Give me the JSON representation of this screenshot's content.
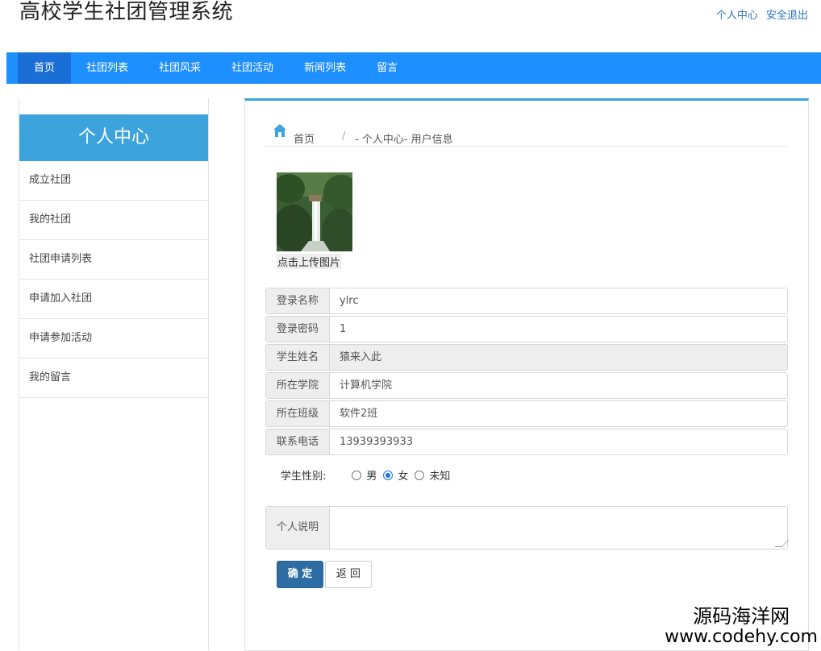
{
  "header": {
    "title": "高校学生社团管理系统",
    "links": {
      "profile": "个人中心",
      "logout": "安全退出"
    }
  },
  "nav": {
    "items": [
      {
        "label": "首页",
        "active": true
      },
      {
        "label": "社团列表"
      },
      {
        "label": "社团风采"
      },
      {
        "label": "社团活动"
      },
      {
        "label": "新闻列表"
      },
      {
        "label": "留言"
      }
    ]
  },
  "sidebar": {
    "heading": "个人中心",
    "items": [
      {
        "label": "成立社团"
      },
      {
        "label": "我的社团"
      },
      {
        "label": "社团申请列表"
      },
      {
        "label": "申请加入社团"
      },
      {
        "label": "申请参加活动"
      },
      {
        "label": "我的留言"
      }
    ]
  },
  "breadcrumb": {
    "home": "首页",
    "separator": "/",
    "current": "- 个人中心- 用户信息"
  },
  "avatar": {
    "upload_label": "点击上传图片"
  },
  "form": {
    "fields": [
      {
        "label": "登录名称",
        "value": "ylrc"
      },
      {
        "label": "登录密码",
        "value": "1"
      },
      {
        "label": "学生姓名",
        "value": "猿来入此",
        "readonly": true
      },
      {
        "label": "所在学院",
        "value": "计算机学院"
      },
      {
        "label": "所在班级",
        "value": "软件2班"
      },
      {
        "label": "联系电话",
        "value": "13939393933"
      }
    ],
    "gender": {
      "label": "学生性别:",
      "options": [
        "男",
        "女",
        "未知"
      ],
      "selected": "女"
    },
    "description": {
      "label": "个人说明",
      "value": ""
    },
    "buttons": {
      "ok": "确 定",
      "back": "返 回"
    }
  },
  "watermark": {
    "cn": "源码海洋网",
    "url": "www.codehy.com"
  },
  "colors": {
    "nav_bg": "#1e8fff",
    "nav_active": "#1a6fd6",
    "sidebar_head": "#3da3dd",
    "primary_btn": "#2e6da4"
  }
}
